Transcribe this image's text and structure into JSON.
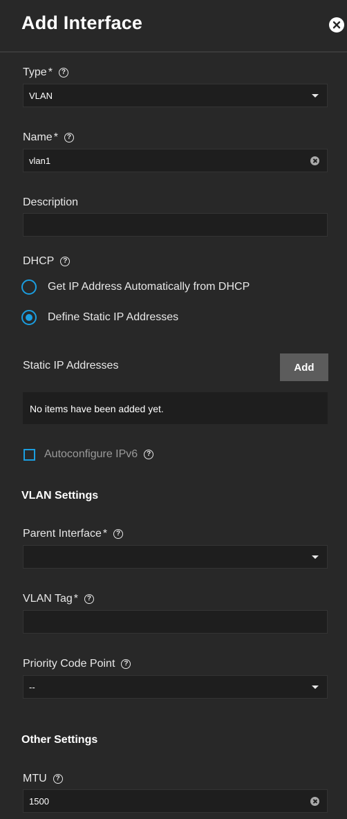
{
  "header": {
    "title": "Add Interface"
  },
  "type": {
    "label": "Type",
    "required": "*",
    "value": "VLAN"
  },
  "name": {
    "label": "Name",
    "required": "*",
    "value": "vlan1"
  },
  "description": {
    "label": "Description",
    "value": ""
  },
  "dhcp": {
    "label": "DHCP",
    "options": [
      {
        "label": "Get IP Address Automatically from DHCP",
        "checked": false
      },
      {
        "label": "Define Static IP Addresses",
        "checked": true
      }
    ]
  },
  "static_ip": {
    "label": "Static IP Addresses",
    "add_label": "Add",
    "empty_text": "No items have been added yet."
  },
  "ipv6": {
    "label": "Autoconfigure IPv6",
    "checked": false
  },
  "vlan_settings": {
    "heading": "VLAN Settings",
    "parent_interface": {
      "label": "Parent Interface",
      "required": "*",
      "value": ""
    },
    "vlan_tag": {
      "label": "VLAN Tag",
      "required": "*",
      "value": ""
    },
    "priority_code_point": {
      "label": "Priority Code Point",
      "value": "--"
    }
  },
  "other_settings": {
    "heading": "Other Settings",
    "mtu": {
      "label": "MTU",
      "value": "1500"
    }
  },
  "colors": {
    "accent": "#1b9ee0",
    "background": "#282828",
    "input_bg": "#1e1e1e",
    "button_bg": "#5c5c5c"
  }
}
